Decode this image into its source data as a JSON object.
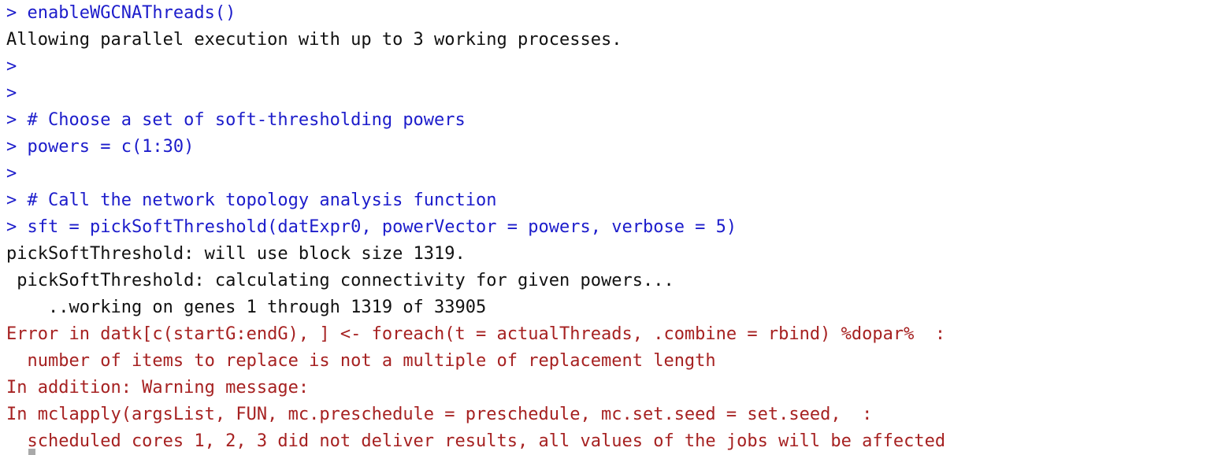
{
  "console": {
    "app": "R Console",
    "prompt_symbol": ">",
    "colors": {
      "input": "#1c1ccb",
      "output": "#111111",
      "error": "#a62121",
      "background": "#ffffff",
      "cursor": "#a9a9a9"
    },
    "lines": [
      {
        "kind": "input",
        "text": "> enableWGCNAThreads()"
      },
      {
        "kind": "output",
        "text": "Allowing parallel execution with up to 3 working processes."
      },
      {
        "kind": "input",
        "text": ">"
      },
      {
        "kind": "input",
        "text": ">"
      },
      {
        "kind": "input",
        "text": "> # Choose a set of soft-thresholding powers"
      },
      {
        "kind": "input",
        "text": "> powers = c(1:30)"
      },
      {
        "kind": "input",
        "text": ">"
      },
      {
        "kind": "input",
        "text": "> # Call the network topology analysis function"
      },
      {
        "kind": "input",
        "text": "> sft = pickSoftThreshold(datExpr0, powerVector = powers, verbose = 5)"
      },
      {
        "kind": "output",
        "text": "pickSoftThreshold: will use block size 1319."
      },
      {
        "kind": "output",
        "text": " pickSoftThreshold: calculating connectivity for given powers..."
      },
      {
        "kind": "output",
        "text": "    ..working on genes 1 through 1319 of 33905"
      },
      {
        "kind": "error",
        "text": "Error in datk[c(startG:endG), ] <- foreach(t = actualThreads, .combine = rbind) %dopar%  :"
      },
      {
        "kind": "error",
        "text": "  number of items to replace is not a multiple of replacement length"
      },
      {
        "kind": "error",
        "text": "In addition: Warning message:"
      },
      {
        "kind": "error",
        "text": "In mclapply(argsList, FUN, mc.preschedule = preschedule, mc.set.seed = set.seed,  :"
      },
      {
        "kind": "error",
        "text": "  scheduled cores 1, 2, 3 did not deliver results, all values of the jobs will be affected"
      }
    ]
  }
}
